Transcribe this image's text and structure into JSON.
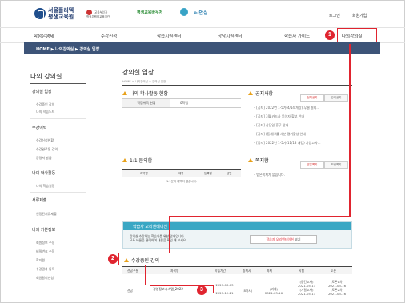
{
  "header": {
    "logo_line1": "서울플리텍",
    "logo_line2": "평생교육원",
    "partners": {
      "p1_line1": "교육부인가",
      "p1_line2": "학점은행제교육기관",
      "p2": "평생교육바우처",
      "p3": "",
      "p5": "e-안심"
    },
    "login": "로그인",
    "join": "회원가입"
  },
  "nav": {
    "items": [
      "학점은행제",
      "수강신청",
      "학습지원센터",
      "상담지원센터",
      "학습자 가이드",
      "나의강의실"
    ]
  },
  "breadcrumb_bar": "HOME ▶ 나의강의실 ▶ 강의실 입장",
  "sidebar": {
    "title": "나의 강의실",
    "groups": [
      {
        "head": "강의실 입장",
        "items": [
          "수강중인 강의",
          "나의 학습노트"
        ]
      },
      {
        "head": "수강이력",
        "items": [
          "수강신청현황",
          "수강완료된 강의",
          "증명서 발급"
        ]
      },
      {
        "head": "나의 학사활동",
        "items": [
          "나의 학습일정"
        ]
      },
      {
        "head": "서류제출",
        "items": [
          "인정된서류제출"
        ]
      },
      {
        "head": "나의 기본정보",
        "items": [
          "회원정보 수정",
          "비밀번호 수정",
          "학지원",
          "수강결과 등록",
          "회원탈퇴신청"
        ]
      }
    ]
  },
  "main": {
    "title": "강의실 입장",
    "crumb": "HOME > 나의강의실 > 강의실 입장",
    "academic": {
      "title": "나의 학사활동 현황",
      "key": "학점취득 현황",
      "value": "0학점"
    },
    "notice": {
      "title": "공지사항",
      "tabs": [
        "전체공지",
        "강의공지"
      ],
      "items": [
        "[공지] 2022년 1-5기(4/14 개강) 무결 철회...",
        "[공지] 3월 카드사 무이자 할부 안내",
        "[공지] 상담일 휴무 안내",
        "[공지] (통계)2를 세분 평가활성 안내",
        "[공지] 2022년 1-5기(11/18 개강) 가입고사..."
      ]
    },
    "qa": {
      "title": "1:1 문의함",
      "columns": [
        "과목명",
        "제목",
        "등록일",
        "답변"
      ],
      "empty": "1:1문의 내역이 없습니다."
    },
    "memo": {
      "title": "쪽지함",
      "tabs": [
        "받은쪽지",
        "보낸쪽지"
      ],
      "empty": "받은쪽지가 없습니다."
    },
    "orientation": {
      "title": "학습자 오리엔테이션",
      "text_line1": "강의실 수강하는 학습자를 위한 안내입니다.",
      "text_line2": "모두 바른을 클릭하여 내용을 확인 해 보세요.",
      "button_hl": "학습자 오리엔테이션",
      "button_rest": " 보기"
    },
    "courses": {
      "title": "수강중인 강의",
      "columns": [
        "전공구분",
        "과목명",
        "학습기간",
        "중지시",
        "과제",
        "시험",
        "토론"
      ],
      "rows": [
        {
          "type": "전공",
          "name": "경영정보시스템_2022",
          "period_start": "2021-03-03",
          "period_sep": "~",
          "period_end": "2021-12-21",
          "stop": "(8차시)",
          "task": "(과제)",
          "task_date": "2021-03-16",
          "exam1": "(중간고사)",
          "exam1_date": "2021-05-13",
          "exam2": "(기말고사)",
          "exam2_date": "2021-05-13",
          "disc1": "(토론1차)",
          "disc1_date": "2021-03-16",
          "disc2": "(토론2차)",
          "disc2_date": "2021-03-16"
        }
      ]
    }
  },
  "callouts": [
    "1",
    "2",
    "3"
  ],
  "colors": {
    "callout": "#e0242f",
    "crumbbar": "#3d5478",
    "orientation_head": "#3aa7c4",
    "section_triangle": "#e8a11a"
  }
}
